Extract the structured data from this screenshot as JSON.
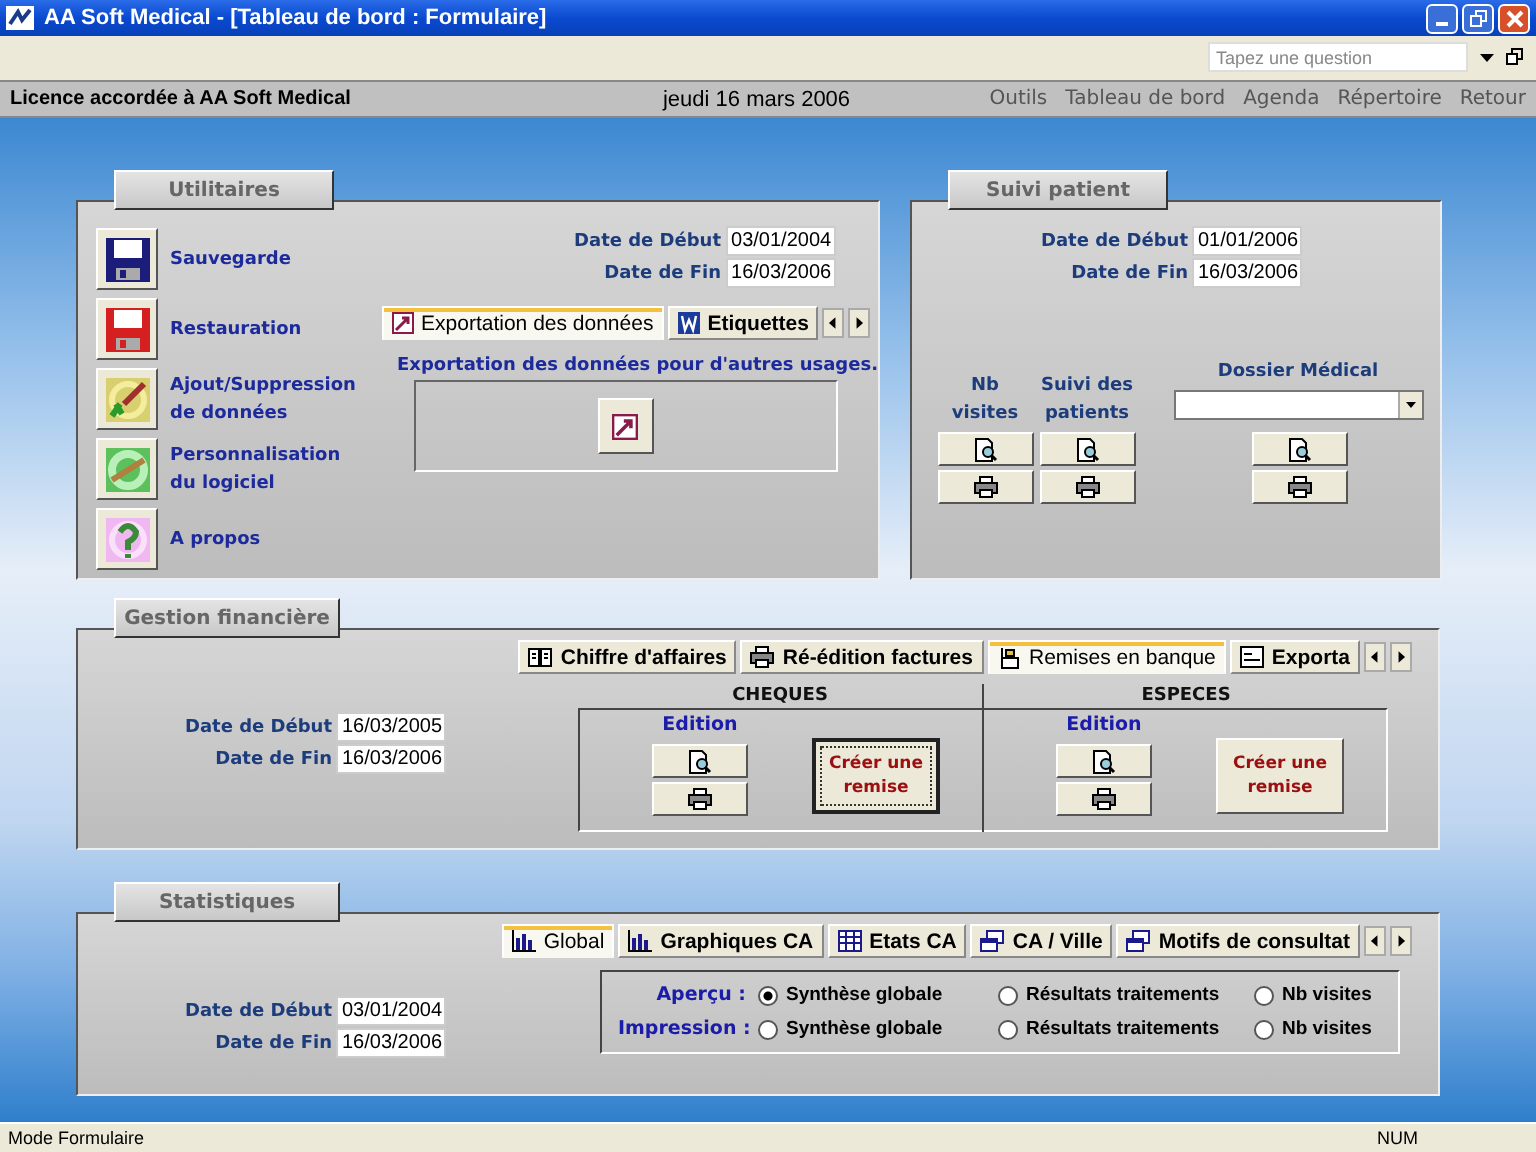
{
  "window": {
    "title": "AA Soft Medical - [Tableau de bord : Formulaire]"
  },
  "help_search": {
    "placeholder": "Tapez une question"
  },
  "header": {
    "license": "Licence accordée à  AA Soft Medical",
    "date": "jeudi 16 mars 2006",
    "links": [
      "Outils",
      "Tableau de bord",
      "Agenda",
      "Répertoire",
      "Retour"
    ]
  },
  "utilitaires": {
    "title": "Utilitaires",
    "actions": [
      {
        "kind": "save",
        "label": "Sauvegarde"
      },
      {
        "kind": "restore",
        "label": "Restauration"
      },
      {
        "kind": "edit",
        "label": "Ajout/Suppression de données"
      },
      {
        "kind": "custom",
        "label": "Personnalisation du logiciel"
      },
      {
        "kind": "help",
        "label": "A propos"
      }
    ],
    "date_debut": {
      "label": "Date de Début",
      "value": "03/01/2004"
    },
    "date_fin": {
      "label": "Date de Fin",
      "value": "16/03/2006"
    },
    "tabs": [
      {
        "kind": "export",
        "label": "Exportation des données",
        "selected": true
      },
      {
        "kind": "word",
        "label": "Etiquettes",
        "selected": false
      }
    ],
    "caption": "Exportation des données pour d'autres usages."
  },
  "suivi_patient": {
    "title": "Suivi patient",
    "date_debut": {
      "label": "Date de Début",
      "value": "01/01/2006"
    },
    "date_fin": {
      "label": "Date de Fin",
      "value": "16/03/2006"
    },
    "columns": [
      {
        "kind": "buttons",
        "label": "Nb visites"
      },
      {
        "kind": "buttons",
        "label": "Suivi des patients"
      },
      {
        "kind": "dropdown",
        "label": "Dossier Médical"
      }
    ]
  },
  "gestion_financiere": {
    "title": "Gestion financière",
    "date_debut": {
      "label": "Date de Début",
      "value": "16/03/2005"
    },
    "date_fin": {
      "label": "Date de Fin",
      "value": "16/03/2006"
    },
    "tabs": [
      {
        "kind": "book",
        "label": "Chiffre d'affaires",
        "selected": false
      },
      {
        "kind": "print",
        "label": "Ré-édition factures",
        "selected": false
      },
      {
        "kind": "bank",
        "label": "Remises en banque",
        "selected": true
      },
      {
        "kind": "form",
        "label": "Exporta",
        "selected": false
      }
    ],
    "sections": [
      {
        "title": "CHEQUES",
        "edition": "Edition",
        "create": "Créer une remise",
        "focused": true
      },
      {
        "title": "ESPECES",
        "edition": "Edition",
        "create": "Créer une remise",
        "focused": false
      }
    ]
  },
  "statistiques": {
    "title": "Statistiques",
    "date_debut": {
      "label": "Date de Début",
      "value": "03/01/2004"
    },
    "date_fin": {
      "label": "Date de Fin",
      "value": "16/03/2006"
    },
    "tabs": [
      {
        "kind": "chart",
        "label": "Global",
        "selected": true
      },
      {
        "kind": "chart",
        "label": "Graphiques CA",
        "selected": false
      },
      {
        "kind": "table",
        "label": "Etats CA",
        "selected": false
      },
      {
        "kind": "windows",
        "label": "CA / Ville",
        "selected": false
      },
      {
        "kind": "windows",
        "label": "Motifs de consultat",
        "selected": false
      }
    ],
    "rows": [
      {
        "label": "Aperçu :",
        "options": [
          {
            "label": "Synthèse globale",
            "selected": true
          },
          {
            "label": "Résultats traitements",
            "selected": false
          },
          {
            "label": "Nb visites",
            "selected": false
          }
        ]
      },
      {
        "label": "Impression :",
        "options": [
          {
            "label": "Synthèse globale",
            "selected": false
          },
          {
            "label": "Résultats traitements",
            "selected": false
          },
          {
            "label": "Nb visites",
            "selected": false
          }
        ]
      }
    ]
  },
  "status_bar": {
    "mode": "Mode Formulaire",
    "num": "NUM"
  }
}
